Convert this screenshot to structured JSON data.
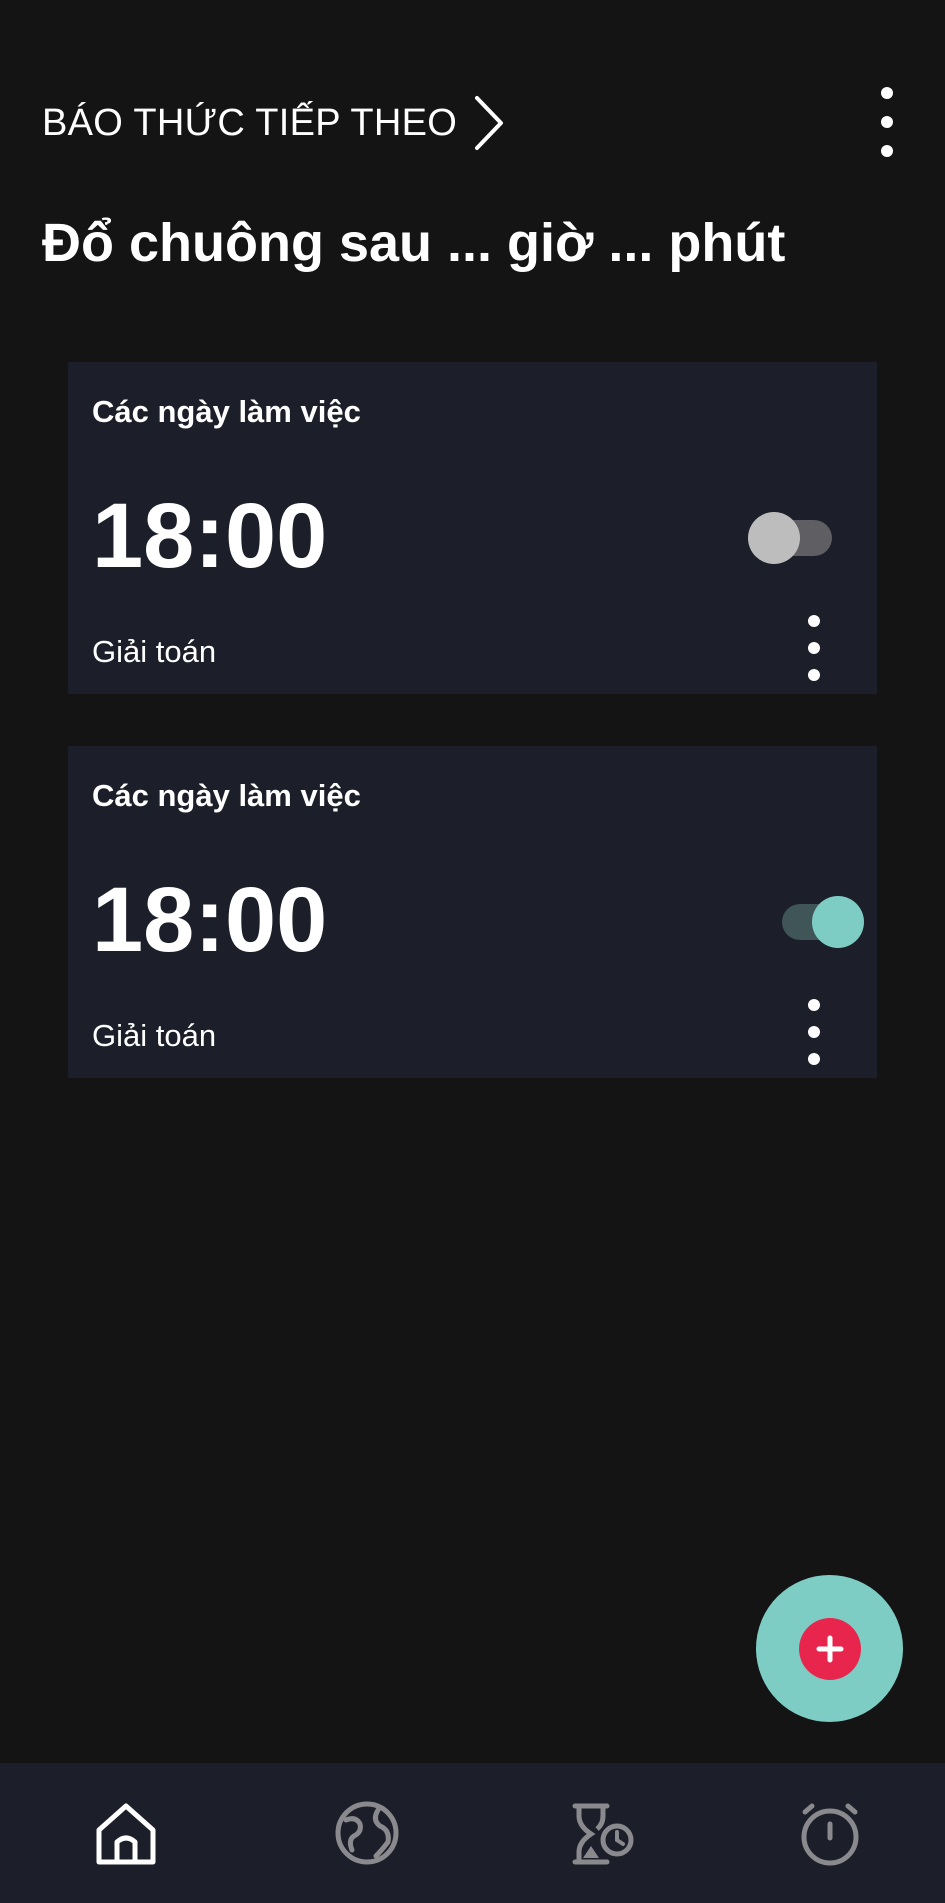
{
  "header": {
    "title": "BÁO THỨC TIẾP THEO",
    "chevron_icon": "chevron-right-icon",
    "menu_icon": "more-vert-icon"
  },
  "subtitle": "Đổ chuông sau ... giờ ... phút",
  "alarms": [
    {
      "days": "Các ngày làm việc",
      "time": "18:00",
      "task": "Giải toán",
      "enabled": false
    },
    {
      "days": "Các ngày làm việc",
      "time": "18:00",
      "task": "Giải toán",
      "enabled": true
    }
  ],
  "fab": {
    "icon": "add-alarm-icon"
  },
  "bottom_nav": [
    {
      "icon": "home-icon",
      "active": true
    },
    {
      "icon": "globe-icon",
      "active": false
    },
    {
      "icon": "hourglass-timer-icon",
      "active": false
    },
    {
      "icon": "stopwatch-icon",
      "active": false
    }
  ],
  "colors": {
    "background": "#141414",
    "card": "#1c1f29",
    "accent": "#7ecdc4",
    "fab_inner": "#e8264d",
    "nav_active": "#ffffff",
    "nav_inactive": "#8a8a8e"
  }
}
